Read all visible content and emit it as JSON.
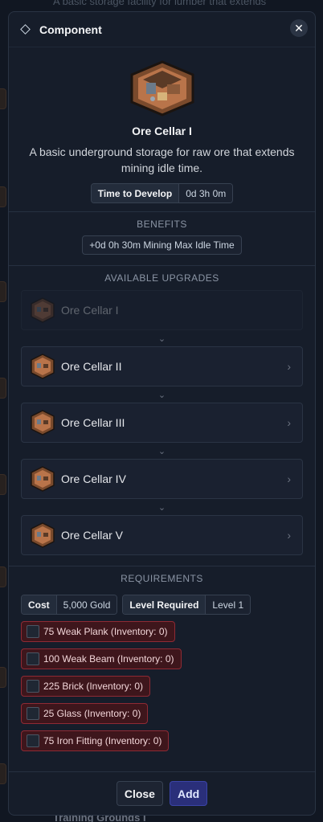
{
  "background": {
    "top_text": "A basic storage facility for lumber that extends",
    "bottom_text": "Training Grounds I"
  },
  "modal": {
    "header_title": "Component",
    "close_glyph": "✕"
  },
  "item": {
    "name": "Ore Cellar I",
    "description": "A basic underground storage for raw ore that extends mining idle time.",
    "develop_label": "Time to Develop",
    "develop_value": "0d 3h 0m"
  },
  "benefits": {
    "heading": "BENEFITS",
    "items": [
      "+0d 0h 30m Mining Max Idle Time"
    ]
  },
  "upgrades": {
    "heading": "AVAILABLE UPGRADES",
    "items": [
      {
        "label": "Ore Cellar I",
        "enabled": false
      },
      {
        "label": "Ore Cellar II",
        "enabled": true
      },
      {
        "label": "Ore Cellar III",
        "enabled": true
      },
      {
        "label": "Ore Cellar IV",
        "enabled": true
      },
      {
        "label": "Ore Cellar V",
        "enabled": true
      }
    ]
  },
  "requirements": {
    "heading": "REQUIREMENTS",
    "cost_label": "Cost",
    "cost_value": "5,000 Gold",
    "level_label": "Level Required",
    "level_value": "Level 1",
    "materials": [
      "75 Weak Plank (Inventory: 0)",
      "100 Weak Beam (Inventory: 0)",
      "225 Brick (Inventory: 0)",
      "25 Glass (Inventory: 0)",
      "75 Iron Fitting (Inventory: 0)"
    ]
  },
  "footer": {
    "close_label": "Close",
    "add_label": "Add"
  },
  "colors": {
    "accent": "#2a2f7a",
    "danger_bg": "#3e161c",
    "danger_border": "#8f2a34"
  }
}
